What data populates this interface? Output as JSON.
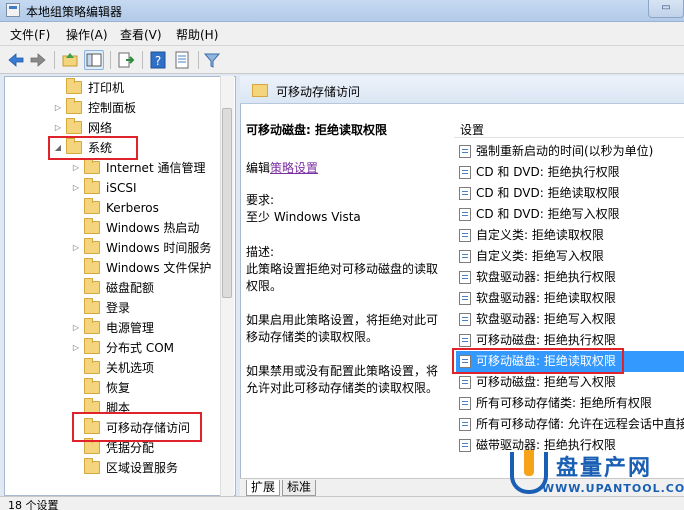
{
  "window": {
    "title": "本地组策略编辑器"
  },
  "menu": [
    "文件(F)",
    "操作(A)",
    "查看(V)",
    "帮助(H)"
  ],
  "toolbar": {
    "icons": [
      "back-arrow-icon",
      "forward-arrow-icon",
      "up-folder-icon",
      "show-hide-tree-icon",
      "export-list-icon",
      "help-icon",
      "properties-icon",
      "filter-icon"
    ]
  },
  "tree": {
    "items": [
      {
        "label": "打印机",
        "arrow": ""
      },
      {
        "label": "控制面板",
        "arrow": "▷"
      },
      {
        "label": "网络",
        "arrow": "▷"
      },
      {
        "label": "系统",
        "arrow": "◢"
      },
      {
        "label": "Internet 通信管理",
        "arrow": "▷"
      },
      {
        "label": "iSCSI",
        "arrow": "▷"
      },
      {
        "label": "Kerberos",
        "arrow": ""
      },
      {
        "label": "Windows 热启动",
        "arrow": ""
      },
      {
        "label": "Windows 时间服务",
        "arrow": "▷"
      },
      {
        "label": "Windows 文件保护",
        "arrow": ""
      },
      {
        "label": "磁盘配额",
        "arrow": ""
      },
      {
        "label": "登录",
        "arrow": ""
      },
      {
        "label": "电源管理",
        "arrow": "▷"
      },
      {
        "label": "分布式 COM",
        "arrow": "▷"
      },
      {
        "label": "关机选项",
        "arrow": ""
      },
      {
        "label": "恢复",
        "arrow": ""
      },
      {
        "label": "脚本",
        "arrow": ""
      },
      {
        "label": "可移动存储访问",
        "arrow": ""
      },
      {
        "label": "凭据分配",
        "arrow": ""
      },
      {
        "label": "区域设置服务",
        "arrow": ""
      }
    ]
  },
  "path_bar": {
    "title": "可移动存储访问"
  },
  "description": {
    "heading": "可移动磁盘: 拒绝读取权限",
    "edit_prefix": "编辑",
    "edit_link": "策略设置",
    "requirement_label": "要求:",
    "requirement_value": "至少 Windows Vista",
    "desc_label": "描述:",
    "desc_text": "此策略设置拒绝对可移动磁盘的读取权限。",
    "enabled_text": "如果启用此策略设置，将拒绝对此可移动存储类的读取权限。",
    "disabled_text": "如果禁用或没有配置此策略设置，将允许对此可移动存储类的读取权限。"
  },
  "settings": {
    "header": "设置",
    "rows": [
      "强制重新启动的时间(以秒为单位)",
      "CD 和 DVD: 拒绝执行权限",
      "CD 和 DVD: 拒绝读取权限",
      "CD 和 DVD: 拒绝写入权限",
      "自定义类: 拒绝读取权限",
      "自定义类: 拒绝写入权限",
      "软盘驱动器: 拒绝执行权限",
      "软盘驱动器: 拒绝读取权限",
      "软盘驱动器: 拒绝写入权限",
      "可移动磁盘: 拒绝执行权限",
      "可移动磁盘: 拒绝读取权限",
      "可移动磁盘: 拒绝写入权限",
      "所有可移动存储类: 拒绝所有权限",
      "所有可移动存储: 允许在远程会话中直接",
      "磁带驱动器: 拒绝执行权限"
    ],
    "selected_index": 10
  },
  "tabs": [
    "扩展",
    "标准"
  ],
  "status": {
    "text": "18 个设置"
  },
  "watermark": {
    "brand": "盘量产网",
    "url": "WWW.UPANTOOL.COM"
  },
  "colors": {
    "selection": "#3399ff",
    "highlight_box": "#e0232a",
    "link": "#7a2fa0"
  }
}
